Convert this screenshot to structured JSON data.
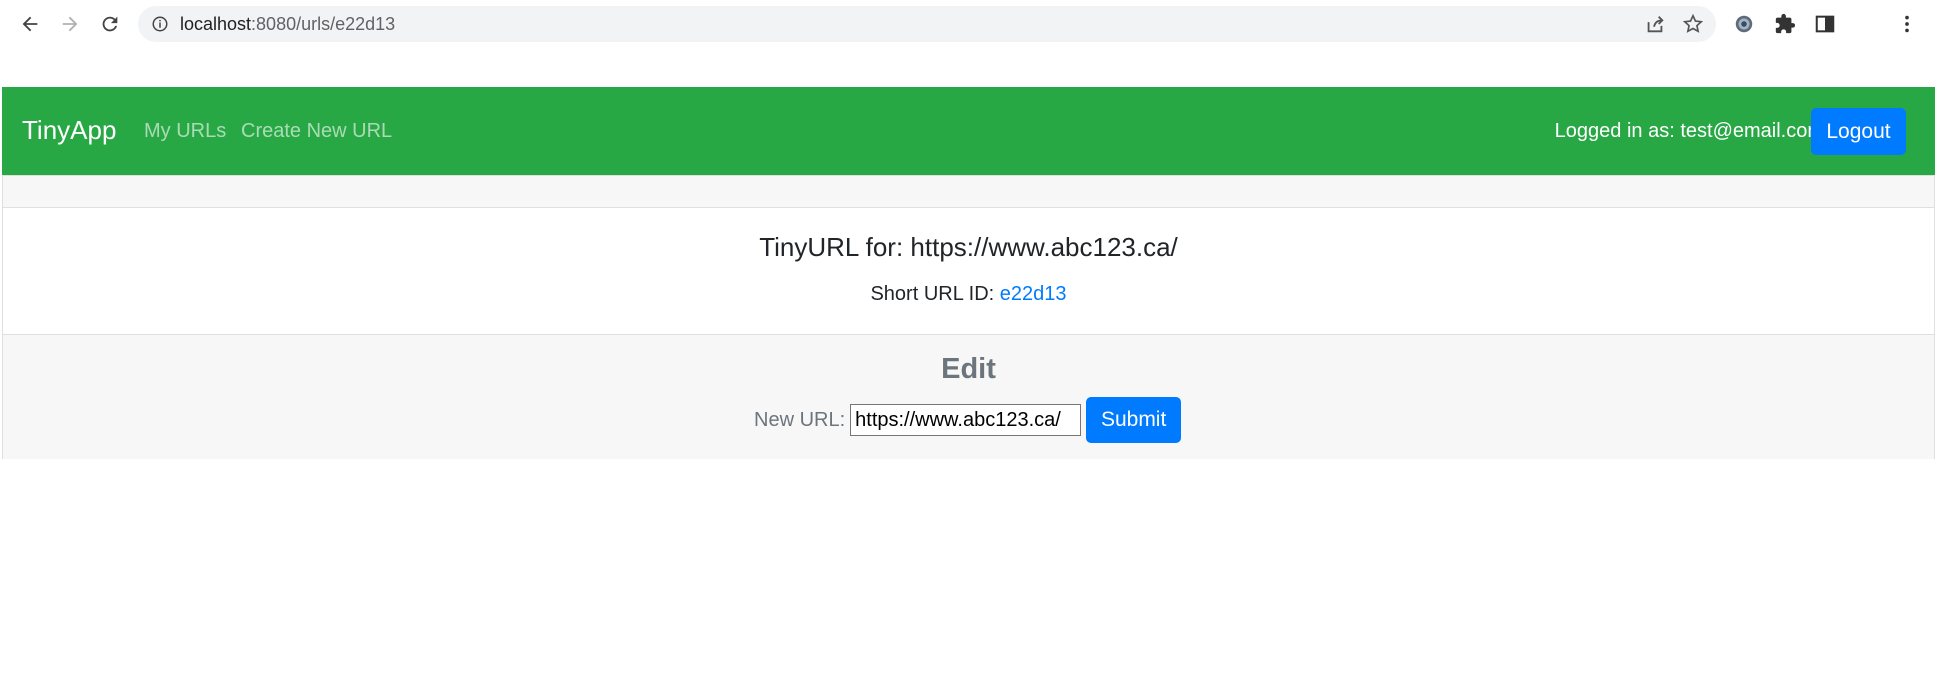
{
  "browser": {
    "url_host": "localhost",
    "url_path": ":8080/urls/e22d13",
    "icons": {
      "back": "back-arrow-icon",
      "forward": "forward-arrow-icon",
      "reload": "reload-icon",
      "info": "site-info-icon",
      "share": "share-icon",
      "bookmark": "star-icon",
      "extension1": "gear-extension-icon",
      "extensions": "puzzle-icon",
      "side_panel": "side-panel-icon",
      "menu": "kebab-menu-icon"
    }
  },
  "navbar": {
    "brand": "TinyApp",
    "links": [
      "My URLs",
      "Create New URL"
    ],
    "logged_in_text": "Logged in as: test@email.com",
    "logout_label": "Logout",
    "color": "#28a745"
  },
  "card": {
    "title": "TinyURL for: https://www.abc123.ca/",
    "short_url_label": "Short URL ID: ",
    "short_url_id": "e22d13"
  },
  "edit": {
    "heading": "Edit",
    "new_url_label": "New URL:",
    "new_url_value": "https://www.abc123.ca/",
    "submit_label": "Submit"
  },
  "colors": {
    "accent": "#007bff",
    "footer_bg": "#f7f7f7"
  }
}
